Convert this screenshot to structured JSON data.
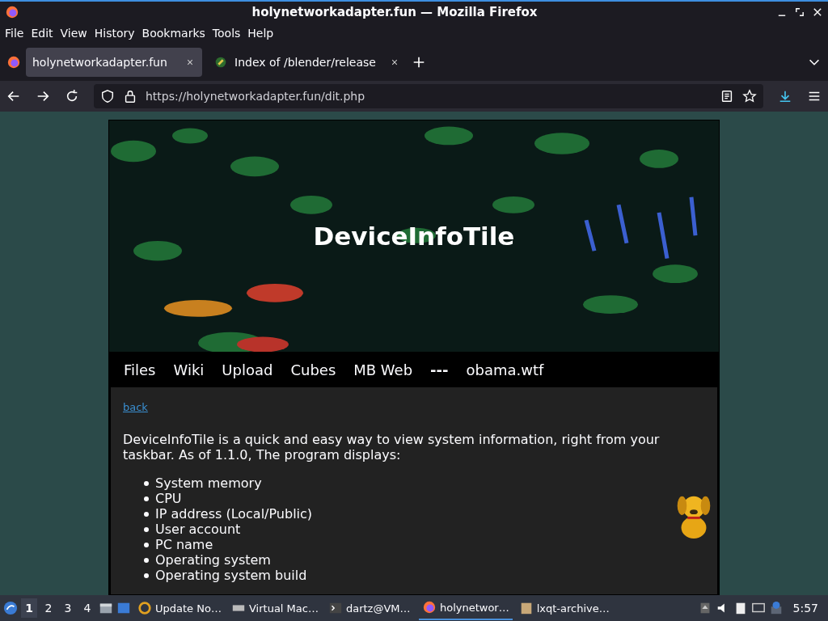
{
  "window": {
    "title": "holynetworkadapter.fun — Mozilla Firefox"
  },
  "menu": [
    "File",
    "Edit",
    "View",
    "History",
    "Bookmarks",
    "Tools",
    "Help"
  ],
  "tabs": [
    {
      "label": "holynetworkadapter.fun",
      "selected": true
    },
    {
      "label": "Index of /blender/release",
      "selected": false
    }
  ],
  "address": {
    "url": "https://holynetworkadapter.fun/dit.php"
  },
  "page": {
    "title": "DeviceInfoTile",
    "nav": [
      {
        "kind": "link",
        "label": "Files"
      },
      {
        "kind": "link",
        "label": "Wiki"
      },
      {
        "kind": "link",
        "label": "Upload"
      },
      {
        "kind": "link",
        "label": "Cubes"
      },
      {
        "kind": "link",
        "label": "MB Web"
      },
      {
        "kind": "separator",
        "label": "---"
      },
      {
        "kind": "link",
        "label": "obama.wtf"
      }
    ],
    "back": "back",
    "intro": "DeviceInfoTile is a quick and easy way to view system information, right from your taskbar. As of 1.1.0, The program displays:",
    "items": [
      "System memory",
      "CPU",
      "IP address (Local/Public)",
      "User account",
      "PC name",
      "Operating system",
      "Operating system build"
    ]
  },
  "taskbar": {
    "workspaces": [
      {
        "label": "1",
        "selected": true
      },
      {
        "label": "2",
        "selected": false
      },
      {
        "label": "3",
        "selected": false
      },
      {
        "label": "4",
        "selected": false
      }
    ],
    "tasks": [
      {
        "label": "Update No…",
        "selected": false
      },
      {
        "label": "Virtual Mac…",
        "selected": false
      },
      {
        "label": "dartz@VM…",
        "selected": false
      },
      {
        "label": "holynetwor…",
        "selected": true
      },
      {
        "label": "lxqt-archive…",
        "selected": false
      }
    ],
    "clock": "5:57"
  }
}
